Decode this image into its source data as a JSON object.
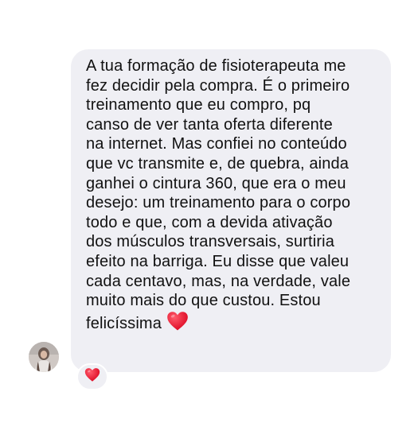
{
  "message": {
    "lines": [
      "A tua formação de fisioterapeuta me",
      "fez decidir pela compra. É o primeiro",
      "treinamento que eu compro, pq",
      "canso de ver tanta oferta diferente",
      "na internet. Mas confiei no conteúdo",
      "que vc transmite e, de quebra, ainda",
      "ganhei o cintura 360, que era o meu",
      "desejo: um treinamento para o corpo",
      "todo e que, com a devida ativação",
      "dos músculos transversais, surtiria",
      "efeito na barriga. Eu disse que valeu",
      "cada centavo, mas, na verdade, vale",
      "muito mais do que custou. Estou",
      "felicíssima"
    ],
    "inline_emoji": "heart-icon",
    "bubble_color": "#efeff4",
    "text_color": "#111111"
  },
  "reaction": {
    "emoji": "heart-icon",
    "color": "#e8112d"
  },
  "sender": {
    "avatar": "avatar-photo"
  }
}
